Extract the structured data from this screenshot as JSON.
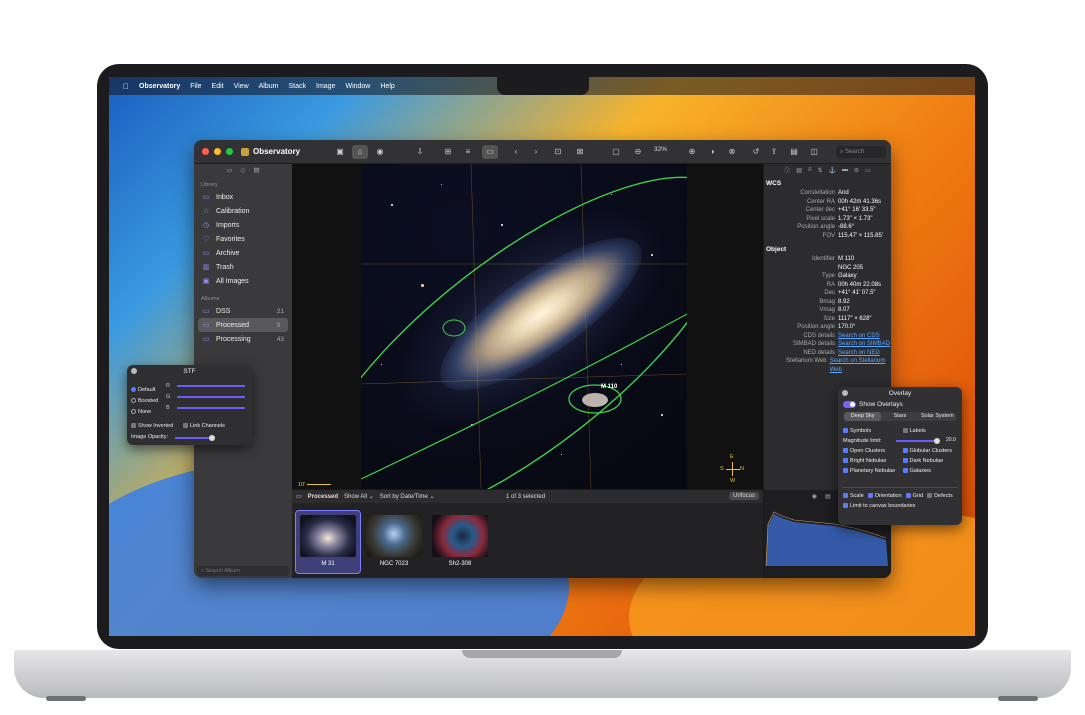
{
  "menubar": {
    "app": "Observatory",
    "items": [
      "File",
      "Edit",
      "View",
      "Album",
      "Stack",
      "Image",
      "Window",
      "Help"
    ]
  },
  "window": {
    "title": "Observatory",
    "zoom": "32%",
    "search_placeholder": "Search"
  },
  "sidebar": {
    "library_heading": "Library",
    "library": [
      {
        "label": "Inbox",
        "icon": "tray-icon"
      },
      {
        "label": "Calibration",
        "icon": "star-icon"
      },
      {
        "label": "Imports",
        "icon": "clock-icon"
      },
      {
        "label": "Favorites",
        "icon": "heart-icon"
      },
      {
        "label": "Archive",
        "icon": "archive-icon"
      },
      {
        "label": "Trash",
        "icon": "trash-icon"
      },
      {
        "label": "All Images",
        "icon": "photos-icon"
      }
    ],
    "albums_heading": "Albums",
    "albums": [
      {
        "label": "DSS",
        "count": "21"
      },
      {
        "label": "Processed",
        "count": "3"
      },
      {
        "label": "Processing",
        "count": "43"
      }
    ],
    "search_placeholder": "Search Album"
  },
  "canvas": {
    "scale_label": "10'",
    "compass": {
      "n": "N",
      "e": "E",
      "s": "S",
      "w": "W"
    },
    "object_label": "M 110"
  },
  "bottombar": {
    "album": "Processed",
    "filter": "Show All",
    "sort": "Sort by Date/Time",
    "status": "1 of 3 selected",
    "unfocus": "Unfocus"
  },
  "thumbnails": [
    {
      "label": "M 31",
      "selected": true
    },
    {
      "label": "NGC 7023",
      "selected": false
    },
    {
      "label": "Sh2-308",
      "selected": false
    }
  ],
  "inspector": {
    "wcs_heading": "WCS",
    "wcs": [
      {
        "k": "Constellation",
        "v": "And"
      },
      {
        "k": "Center RA",
        "v": "00h 42m 41.36s"
      },
      {
        "k": "Center dec",
        "v": "+41° 16' 33.5\""
      },
      {
        "k": "Pixel scale",
        "v": "1.73\"   × 1.73\""
      },
      {
        "k": "Position angle",
        "v": "-88.6°"
      },
      {
        "k": "FOV",
        "v": "115.47'   × 115.85'"
      }
    ],
    "object_heading": "Object",
    "object": [
      {
        "k": "Identifier",
        "v": "M 110"
      },
      {
        "k": "",
        "v": "NGC 205"
      },
      {
        "k": "Type",
        "v": "Galaxy"
      },
      {
        "k": "RA",
        "v": "00h 40m 22.08s"
      },
      {
        "k": "Dec",
        "v": "+41° 41' 07.5\""
      },
      {
        "k": "Bmag",
        "v": "8.92"
      },
      {
        "k": "Vmag",
        "v": "8.07"
      },
      {
        "k": "Size",
        "v": "1117\"   × 628\""
      },
      {
        "k": "Position angle",
        "v": "170.0°"
      }
    ],
    "links": [
      {
        "k": "CDS details",
        "v": "Search on CDS"
      },
      {
        "k": "SIMBAD details",
        "v": "Search on SIMBAD"
      },
      {
        "k": "NED details",
        "v": "Search on NED"
      },
      {
        "k": "Stellarium Web",
        "v": "Search on Stellarium Web"
      }
    ]
  },
  "overlay": {
    "title": "Overlay",
    "show": "Show Overlays",
    "tabs": [
      "Deep Sky",
      "Stars",
      "Solar System"
    ],
    "symbols": "Symbols",
    "labels": "Labels",
    "mag_label": "Magnitude limit:",
    "mag_value": "20.0",
    "checks": [
      [
        "Open Clusters",
        "Globular Clusters"
      ],
      [
        "Bright Nebulae",
        "Dark Nebulae"
      ],
      [
        "Planetary Nebulae",
        "Galaxies"
      ]
    ],
    "bottom": [
      "Scale",
      "Orientation",
      "Grid",
      "Defects"
    ],
    "limit": "Limit to canvas boundaries"
  },
  "stf": {
    "title": "STF",
    "modes": [
      "Default",
      "Boosted",
      "None"
    ],
    "channels": [
      "R",
      "G",
      "B"
    ],
    "show_inverted": "Show Inverted",
    "link_channels": "Link Channels",
    "opacity": "Image Opacity:"
  }
}
